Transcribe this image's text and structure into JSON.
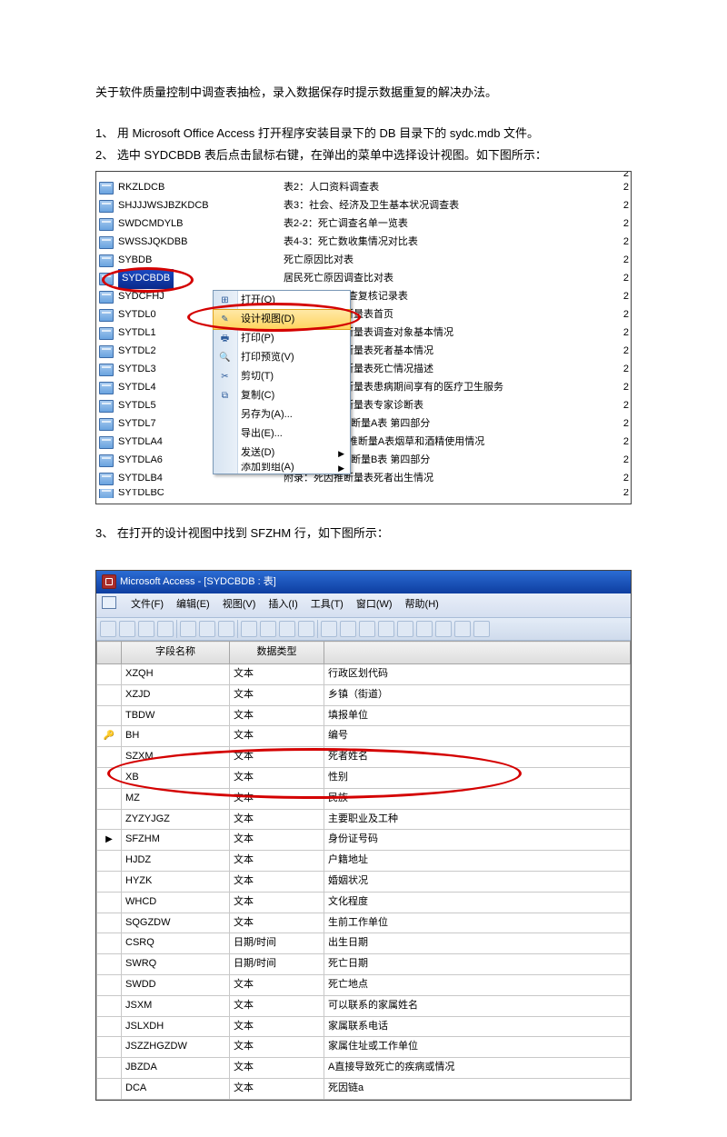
{
  "doc": {
    "title_line": "关于软件质量控制中调查表抽检，录入数据保存时提示数据重复的解决办法。",
    "step1": "1、 用 Microsoft Office Access 打开程序安装目录下的 DB 目录下的 sydc.mdb 文件。",
    "step2": "2、 选中 SYDCBDB 表后点击鼠标右键，在弹出的菜单中选择设计视图。如下图所示：",
    "step3": "3、 在打开的设计视图中找到 SFZHM 行，如下图所示："
  },
  "ss1": {
    "rightval": "2",
    "tables": [
      {
        "name": "RKZLDCB",
        "desc": "表2：人口资料调查表"
      },
      {
        "name": "SHJJJWSJBZKDCB",
        "desc": "表3：社会、经济及卫生基本状况调查表"
      },
      {
        "name": "SWDCMDYLB",
        "desc": "表2-2：死亡调查名单一览表"
      },
      {
        "name": "SWSSJQKDBB",
        "desc": "表4-3：死亡数收集情况对比表"
      },
      {
        "name": "SYBDB",
        "desc": "死亡原因比对表"
      },
      {
        "name": "SYDCBDB",
        "desc": "居民死亡原因调查比对表",
        "selected": true
      },
      {
        "name": "SYDCFHJ",
        "desc": "表4-6：死因调查复核记录表"
      },
      {
        "name": "SYTDL0",
        "desc": "附录：死因推断量表首页"
      },
      {
        "name": "SYTDL1",
        "desc": "附录：死因推断量表调查对象基本情况"
      },
      {
        "name": "SYTDL2",
        "desc": "附录：死因推断量表死者基本情况"
      },
      {
        "name": "SYTDL3",
        "desc": "附录：死因推断量表死亡情况描述"
      },
      {
        "name": "SYTDL4",
        "desc": "附录：死因推断量表患病期间享有的医疗卫生服务"
      },
      {
        "name": "SYTDL5",
        "desc": "附录：死因推断量表专家诊断表"
      },
      {
        "name": "SYTDL7",
        "desc": "附录1-1 死因推断量A表 第四部分"
      },
      {
        "name": "SYTDLA4",
        "desc": "附录1-1：死因推断量A表烟草和酒精使用情况"
      },
      {
        "name": "SYTDLA6",
        "desc": "附录1-2 死因推断量B表 第四部分"
      },
      {
        "name": "SYTDLB4",
        "desc": "附录：死因推断量表死者出生情况"
      },
      {
        "name": "SYTDLBC",
        "desc": ""
      }
    ],
    "menu": [
      {
        "label": "打开(O)",
        "icon": "⊞"
      },
      {
        "label": "设计视图(D)",
        "icon": "✎",
        "hover": true
      },
      {
        "label": "打印(P)",
        "icon": "🖶"
      },
      {
        "label": "打印预览(V)",
        "icon": "🔍"
      },
      {
        "label": "剪切(T)",
        "icon": "✂"
      },
      {
        "label": "复制(C)",
        "icon": "⧉"
      },
      {
        "label": "另存为(A)...",
        "icon": ""
      },
      {
        "label": "导出(E)...",
        "icon": ""
      },
      {
        "label": "发送(D)",
        "icon": "",
        "sub": true
      },
      {
        "label": "添加到组(A)",
        "icon": "",
        "sub": true
      }
    ],
    "toprow": {
      "name": "",
      "desc": ""
    }
  },
  "ss2": {
    "titlebar": "Microsoft Access - [SYDCBDB : 表]",
    "menus": [
      "文件(F)",
      "编辑(E)",
      "视图(V)",
      "插入(I)",
      "工具(T)",
      "窗口(W)",
      "帮助(H)"
    ],
    "headers": [
      "字段名称",
      "数据类型",
      "",
      "···"
    ],
    "fields": [
      {
        "name": "XZQH",
        "type": "文本",
        "desc": "行政区划代码"
      },
      {
        "name": "XZJD",
        "type": "文本",
        "desc": "乡镇（街道）"
      },
      {
        "name": "TBDW",
        "type": "文本",
        "desc": "填报单位"
      },
      {
        "name": "BH",
        "type": "文本",
        "desc": "编号",
        "key": true
      },
      {
        "name": "SZXM",
        "type": "文本",
        "desc": "死者姓名"
      },
      {
        "name": "XB",
        "type": "文本",
        "desc": "性别"
      },
      {
        "name": "MZ",
        "type": "文本",
        "desc": "民族"
      },
      {
        "name": "ZYZYJGZ",
        "type": "文本",
        "desc": "主要职业及工种"
      },
      {
        "name": "SFZHM",
        "type": "文本",
        "desc": "身份证号码",
        "cursor": true
      },
      {
        "name": "HJDZ",
        "type": "文本",
        "desc": "户籍地址"
      },
      {
        "name": "HYZK",
        "type": "文本",
        "desc": "婚姻状况"
      },
      {
        "name": "WHCD",
        "type": "文本",
        "desc": "文化程度"
      },
      {
        "name": "SQGZDW",
        "type": "文本",
        "desc": "生前工作单位"
      },
      {
        "name": "CSRQ",
        "type": "日期/时间",
        "desc": "出生日期"
      },
      {
        "name": "SWRQ",
        "type": "日期/时间",
        "desc": "死亡日期"
      },
      {
        "name": "SWDD",
        "type": "文本",
        "desc": "死亡地点"
      },
      {
        "name": "JSXM",
        "type": "文本",
        "desc": "可以联系的家属姓名"
      },
      {
        "name": "JSLXDH",
        "type": "文本",
        "desc": "家属联系电话"
      },
      {
        "name": "JSZZHGZDW",
        "type": "文本",
        "desc": "家属住址或工作单位"
      },
      {
        "name": "JBZDA",
        "type": "文本",
        "desc": "A直接导致死亡的疾病或情况"
      },
      {
        "name": "DCA",
        "type": "文本",
        "desc": "死因链a"
      }
    ]
  }
}
